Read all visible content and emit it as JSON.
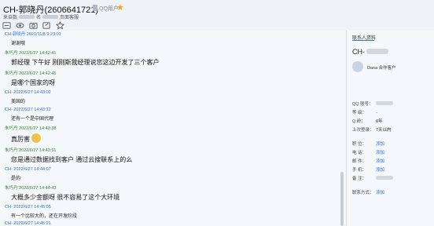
{
  "window": {
    "title": "CH-郭晓丹(2606641721)",
    "tag": "QQ用户",
    "subtitle_prefix": "来自数",
    "subtitle_mid": "名",
    "subtitle_suffix": "页面客服"
  },
  "chat": {
    "messages": [
      {
        "header": "CH-郭晓丹  2021/11/8 9:23:01",
        "header_color": "blue",
        "text": "谢谢哦",
        "size": "small"
      },
      {
        "header": "朱巧丹  2022/6/27 14:42:41",
        "header_color": "green",
        "text": "郭经理 下午好 刚刚斯我经理说您这边开发了三个客户",
        "size": "large"
      },
      {
        "header": "朱巧丹  2022/6/27 14:42:45",
        "header_color": "green",
        "text": "是哪个国家的呀",
        "size": "large"
      },
      {
        "header": "CH-  2022/6/27 14:43:02",
        "header_color": "blue",
        "text": "美国的",
        "size": "small"
      },
      {
        "header": "CH-  2022/6/27 14:43:12",
        "header_color": "blue",
        "text": "还有一个是中国代理",
        "size": "small"
      },
      {
        "header": "朱巧丹  2022/6/27 14:43:38",
        "header_color": "green",
        "text": "真厉害",
        "size": "large",
        "emoji": "thumbs-up"
      },
      {
        "header": "朱巧丹  2022/6/27 14:43:51",
        "header_color": "green",
        "text": "您是通过数据找到客户 通过云搜联系上的么",
        "size": "large"
      },
      {
        "header": "CH-  2022/6/27 14:44:07",
        "header_color": "blue",
        "text": "是的",
        "size": "small"
      },
      {
        "header": "朱巧丹  2022/6/27 14:44:43",
        "header_color": "green",
        "text": "大概多少金额呀 很不容易了这个大环境",
        "size": "large"
      },
      {
        "header": "CH-  2022/6/27 14:45:05",
        "header_color": "blue",
        "text": "有一个比较大的，还在开发阶段",
        "size": "small"
      },
      {
        "header": "CH-  2022/6/27 14:45:21",
        "header_color": "blue",
        "text": "",
        "size": "small"
      }
    ]
  },
  "panel": {
    "tab_label": "联系人资料",
    "name_prefix": "CH-",
    "company": "Dana 合作客户",
    "info": [
      {
        "key": "QQ 账号：",
        "value": "",
        "blurred": true
      },
      {
        "key": "等    级：",
        "value": "-"
      },
      {
        "key": "Q      龄：",
        "value": "0年"
      },
      {
        "key": "上次登录：",
        "value": "7天以内"
      },
      {
        "key": "职    位：",
        "value": "添加",
        "link": true
      },
      {
        "key": "电    话：",
        "value": "添加",
        "link": true
      },
      {
        "key": "邮    件：",
        "value": "添加",
        "link": true
      },
      {
        "key": "手    机：",
        "value": "添加",
        "link": true
      },
      {
        "key": "备    注：",
        "value": "",
        "blurred": true
      },
      {
        "key": "联系方式：",
        "value": "添加",
        "link": true
      }
    ]
  },
  "colors": {
    "accent": "#2e6fd0",
    "green_name": "#2d8a2d",
    "star": "#e6a817"
  },
  "icons": [
    "menu-icon",
    "view-icon",
    "screenshot-icon",
    "edit-icon",
    "star-outline-icon"
  ]
}
